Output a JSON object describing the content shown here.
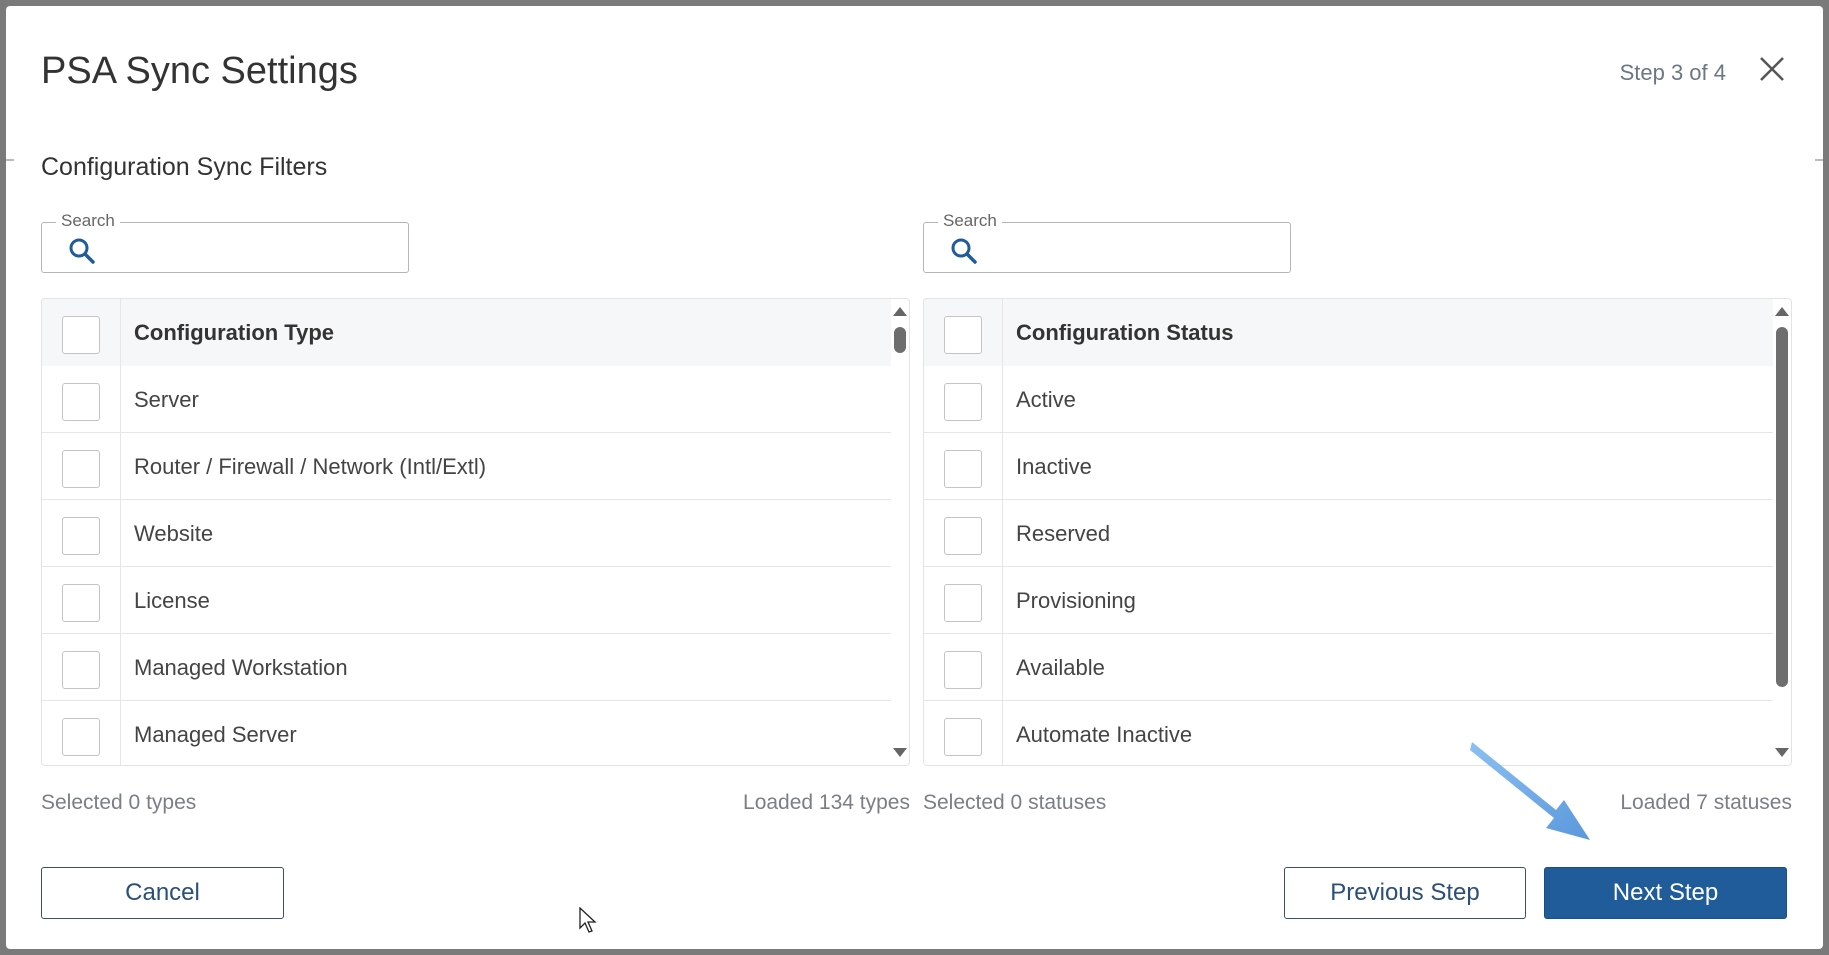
{
  "dialog": {
    "title": "PSA Sync Settings",
    "step": "Step 3 of 4",
    "close_icon": "close-icon"
  },
  "section": {
    "title": "Configuration Sync Filters"
  },
  "left": {
    "search": {
      "label": "Search",
      "value": "",
      "icon": "search-icon"
    },
    "header": "Configuration Type",
    "items": [
      "Server",
      "Router / Firewall / Network (Intl/Extl)",
      "Website",
      "License",
      "Managed Workstation",
      "Managed Server"
    ],
    "selected": "Selected 0 types",
    "loaded": "Loaded 134 types"
  },
  "right": {
    "search": {
      "label": "Search",
      "value": "",
      "icon": "search-icon"
    },
    "header": "Configuration Status",
    "items": [
      "Active",
      "Inactive",
      "Reserved",
      "Provisioning",
      "Available",
      "Automate Inactive"
    ],
    "selected": "Selected 0 statuses",
    "loaded": "Loaded 7 statuses"
  },
  "buttons": {
    "cancel": "Cancel",
    "previous": "Previous Step",
    "next": "Next Step"
  },
  "colors": {
    "primary": "#1f5c99",
    "annotation_arrow": "#6aa6e6"
  }
}
